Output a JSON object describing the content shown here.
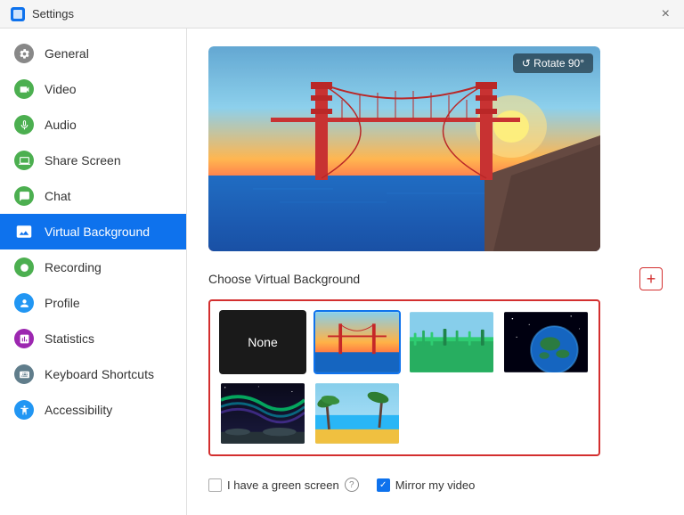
{
  "titleBar": {
    "title": "Settings",
    "closeLabel": "×"
  },
  "sidebar": {
    "items": [
      {
        "id": "general",
        "label": "General",
        "icon": "⚙",
        "iconClass": "icon-general",
        "active": false
      },
      {
        "id": "video",
        "label": "Video",
        "icon": "▶",
        "iconClass": "icon-video",
        "active": false
      },
      {
        "id": "audio",
        "label": "Audio",
        "icon": "🎧",
        "iconClass": "icon-audio",
        "active": false
      },
      {
        "id": "share-screen",
        "label": "Share Screen",
        "icon": "⬆",
        "iconClass": "icon-sharescreen",
        "active": false
      },
      {
        "id": "chat",
        "label": "Chat",
        "icon": "💬",
        "iconClass": "icon-chat",
        "active": false
      },
      {
        "id": "virtual-background",
        "label": "Virtual Background",
        "icon": "🖼",
        "iconClass": "icon-vb",
        "active": true
      },
      {
        "id": "recording",
        "label": "Recording",
        "icon": "⏺",
        "iconClass": "icon-recording",
        "active": false
      },
      {
        "id": "profile",
        "label": "Profile",
        "icon": "👤",
        "iconClass": "icon-profile",
        "active": false
      },
      {
        "id": "statistics",
        "label": "Statistics",
        "icon": "📊",
        "iconClass": "icon-statistics",
        "active": false
      },
      {
        "id": "keyboard-shortcuts",
        "label": "Keyboard Shortcuts",
        "icon": "⌨",
        "iconClass": "icon-keyboard",
        "active": false
      },
      {
        "id": "accessibility",
        "label": "Accessibility",
        "icon": "♿",
        "iconClass": "icon-accessibility",
        "active": false
      }
    ]
  },
  "content": {
    "rotateLabel": "↺ Rotate 90°",
    "chooseLabel": "Choose Virtual Background",
    "addButtonLabel": "+",
    "backgrounds": [
      {
        "id": "none",
        "label": "None",
        "type": "none"
      },
      {
        "id": "golden-gate",
        "label": "Golden Gate",
        "type": "golden-gate",
        "selected": true
      },
      {
        "id": "green-field",
        "label": "Green Field",
        "type": "green-field"
      },
      {
        "id": "earth-space",
        "label": "Earth from Space",
        "type": "earth-space"
      },
      {
        "id": "aurora",
        "label": "Aurora",
        "type": "aurora"
      },
      {
        "id": "beach",
        "label": "Beach",
        "type": "beach"
      }
    ],
    "greenScreenLabel": "I have a green screen",
    "mirrorLabel": "Mirror my video",
    "greenScreenChecked": false,
    "mirrorChecked": true
  }
}
